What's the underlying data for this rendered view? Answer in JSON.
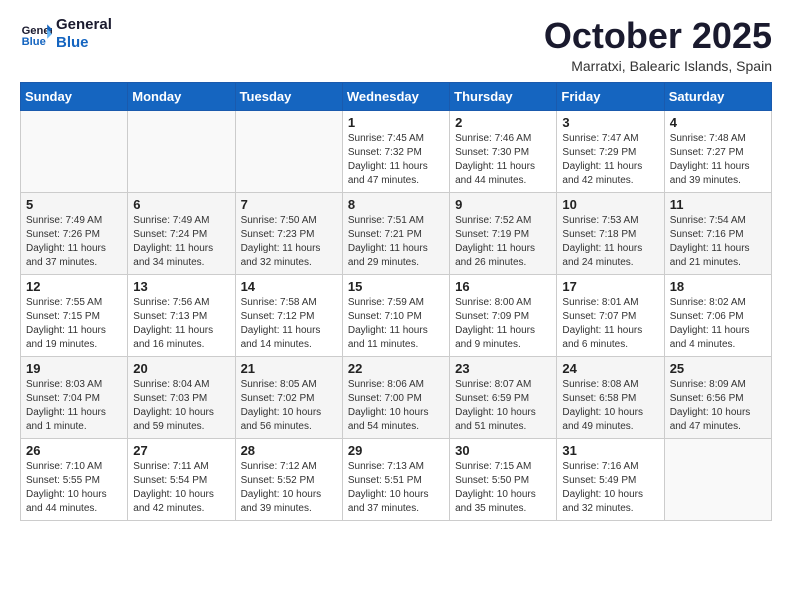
{
  "logo": {
    "line1": "General",
    "line2": "Blue"
  },
  "header": {
    "month": "October 2025",
    "location": "Marratxi, Balearic Islands, Spain"
  },
  "weekdays": [
    "Sunday",
    "Monday",
    "Tuesday",
    "Wednesday",
    "Thursday",
    "Friday",
    "Saturday"
  ],
  "weeks": [
    [
      {
        "day": "",
        "info": ""
      },
      {
        "day": "",
        "info": ""
      },
      {
        "day": "",
        "info": ""
      },
      {
        "day": "1",
        "info": "Sunrise: 7:45 AM\nSunset: 7:32 PM\nDaylight: 11 hours\nand 47 minutes."
      },
      {
        "day": "2",
        "info": "Sunrise: 7:46 AM\nSunset: 7:30 PM\nDaylight: 11 hours\nand 44 minutes."
      },
      {
        "day": "3",
        "info": "Sunrise: 7:47 AM\nSunset: 7:29 PM\nDaylight: 11 hours\nand 42 minutes."
      },
      {
        "day": "4",
        "info": "Sunrise: 7:48 AM\nSunset: 7:27 PM\nDaylight: 11 hours\nand 39 minutes."
      }
    ],
    [
      {
        "day": "5",
        "info": "Sunrise: 7:49 AM\nSunset: 7:26 PM\nDaylight: 11 hours\nand 37 minutes."
      },
      {
        "day": "6",
        "info": "Sunrise: 7:49 AM\nSunset: 7:24 PM\nDaylight: 11 hours\nand 34 minutes."
      },
      {
        "day": "7",
        "info": "Sunrise: 7:50 AM\nSunset: 7:23 PM\nDaylight: 11 hours\nand 32 minutes."
      },
      {
        "day": "8",
        "info": "Sunrise: 7:51 AM\nSunset: 7:21 PM\nDaylight: 11 hours\nand 29 minutes."
      },
      {
        "day": "9",
        "info": "Sunrise: 7:52 AM\nSunset: 7:19 PM\nDaylight: 11 hours\nand 26 minutes."
      },
      {
        "day": "10",
        "info": "Sunrise: 7:53 AM\nSunset: 7:18 PM\nDaylight: 11 hours\nand 24 minutes."
      },
      {
        "day": "11",
        "info": "Sunrise: 7:54 AM\nSunset: 7:16 PM\nDaylight: 11 hours\nand 21 minutes."
      }
    ],
    [
      {
        "day": "12",
        "info": "Sunrise: 7:55 AM\nSunset: 7:15 PM\nDaylight: 11 hours\nand 19 minutes."
      },
      {
        "day": "13",
        "info": "Sunrise: 7:56 AM\nSunset: 7:13 PM\nDaylight: 11 hours\nand 16 minutes."
      },
      {
        "day": "14",
        "info": "Sunrise: 7:58 AM\nSunset: 7:12 PM\nDaylight: 11 hours\nand 14 minutes."
      },
      {
        "day": "15",
        "info": "Sunrise: 7:59 AM\nSunset: 7:10 PM\nDaylight: 11 hours\nand 11 minutes."
      },
      {
        "day": "16",
        "info": "Sunrise: 8:00 AM\nSunset: 7:09 PM\nDaylight: 11 hours\nand 9 minutes."
      },
      {
        "day": "17",
        "info": "Sunrise: 8:01 AM\nSunset: 7:07 PM\nDaylight: 11 hours\nand 6 minutes."
      },
      {
        "day": "18",
        "info": "Sunrise: 8:02 AM\nSunset: 7:06 PM\nDaylight: 11 hours\nand 4 minutes."
      }
    ],
    [
      {
        "day": "19",
        "info": "Sunrise: 8:03 AM\nSunset: 7:04 PM\nDaylight: 11 hours\nand 1 minute."
      },
      {
        "day": "20",
        "info": "Sunrise: 8:04 AM\nSunset: 7:03 PM\nDaylight: 10 hours\nand 59 minutes."
      },
      {
        "day": "21",
        "info": "Sunrise: 8:05 AM\nSunset: 7:02 PM\nDaylight: 10 hours\nand 56 minutes."
      },
      {
        "day": "22",
        "info": "Sunrise: 8:06 AM\nSunset: 7:00 PM\nDaylight: 10 hours\nand 54 minutes."
      },
      {
        "day": "23",
        "info": "Sunrise: 8:07 AM\nSunset: 6:59 PM\nDaylight: 10 hours\nand 51 minutes."
      },
      {
        "day": "24",
        "info": "Sunrise: 8:08 AM\nSunset: 6:58 PM\nDaylight: 10 hours\nand 49 minutes."
      },
      {
        "day": "25",
        "info": "Sunrise: 8:09 AM\nSunset: 6:56 PM\nDaylight: 10 hours\nand 47 minutes."
      }
    ],
    [
      {
        "day": "26",
        "info": "Sunrise: 7:10 AM\nSunset: 5:55 PM\nDaylight: 10 hours\nand 44 minutes."
      },
      {
        "day": "27",
        "info": "Sunrise: 7:11 AM\nSunset: 5:54 PM\nDaylight: 10 hours\nand 42 minutes."
      },
      {
        "day": "28",
        "info": "Sunrise: 7:12 AM\nSunset: 5:52 PM\nDaylight: 10 hours\nand 39 minutes."
      },
      {
        "day": "29",
        "info": "Sunrise: 7:13 AM\nSunset: 5:51 PM\nDaylight: 10 hours\nand 37 minutes."
      },
      {
        "day": "30",
        "info": "Sunrise: 7:15 AM\nSunset: 5:50 PM\nDaylight: 10 hours\nand 35 minutes."
      },
      {
        "day": "31",
        "info": "Sunrise: 7:16 AM\nSunset: 5:49 PM\nDaylight: 10 hours\nand 32 minutes."
      },
      {
        "day": "",
        "info": ""
      }
    ]
  ]
}
